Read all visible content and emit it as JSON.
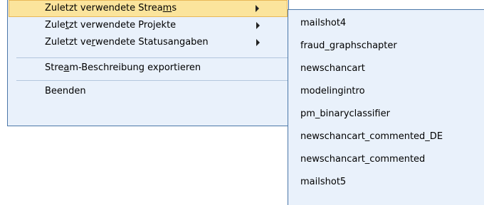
{
  "menu": {
    "items": [
      {
        "pre": "Zuletzt verwendete Strea",
        "mn": "m",
        "post": "s"
      },
      {
        "pre": "Zule",
        "mn": "t",
        "post": "zt verwendete Projekte"
      },
      {
        "pre": "Zuletzt ve",
        "mn": "r",
        "post": "wendete Statusangaben"
      },
      {
        "pre": "Stre",
        "mn": "a",
        "post": "m-Beschreibung exportieren"
      },
      {
        "label": "Beenden"
      }
    ]
  },
  "submenu": {
    "items": [
      "mailshot4",
      "fraud_graphschapter",
      "newschancart",
      "modelingintro",
      "pm_binaryclassifier",
      "newschancart_commented_DE",
      "newschancart_commented",
      "mailshot5"
    ]
  },
  "colors": {
    "menu_bg": "#e9f1fb",
    "border": "#4b77a8",
    "highlight_bg": "#fbe49c",
    "highlight_border": "#e8b858",
    "separator": "#b3c6dd"
  }
}
